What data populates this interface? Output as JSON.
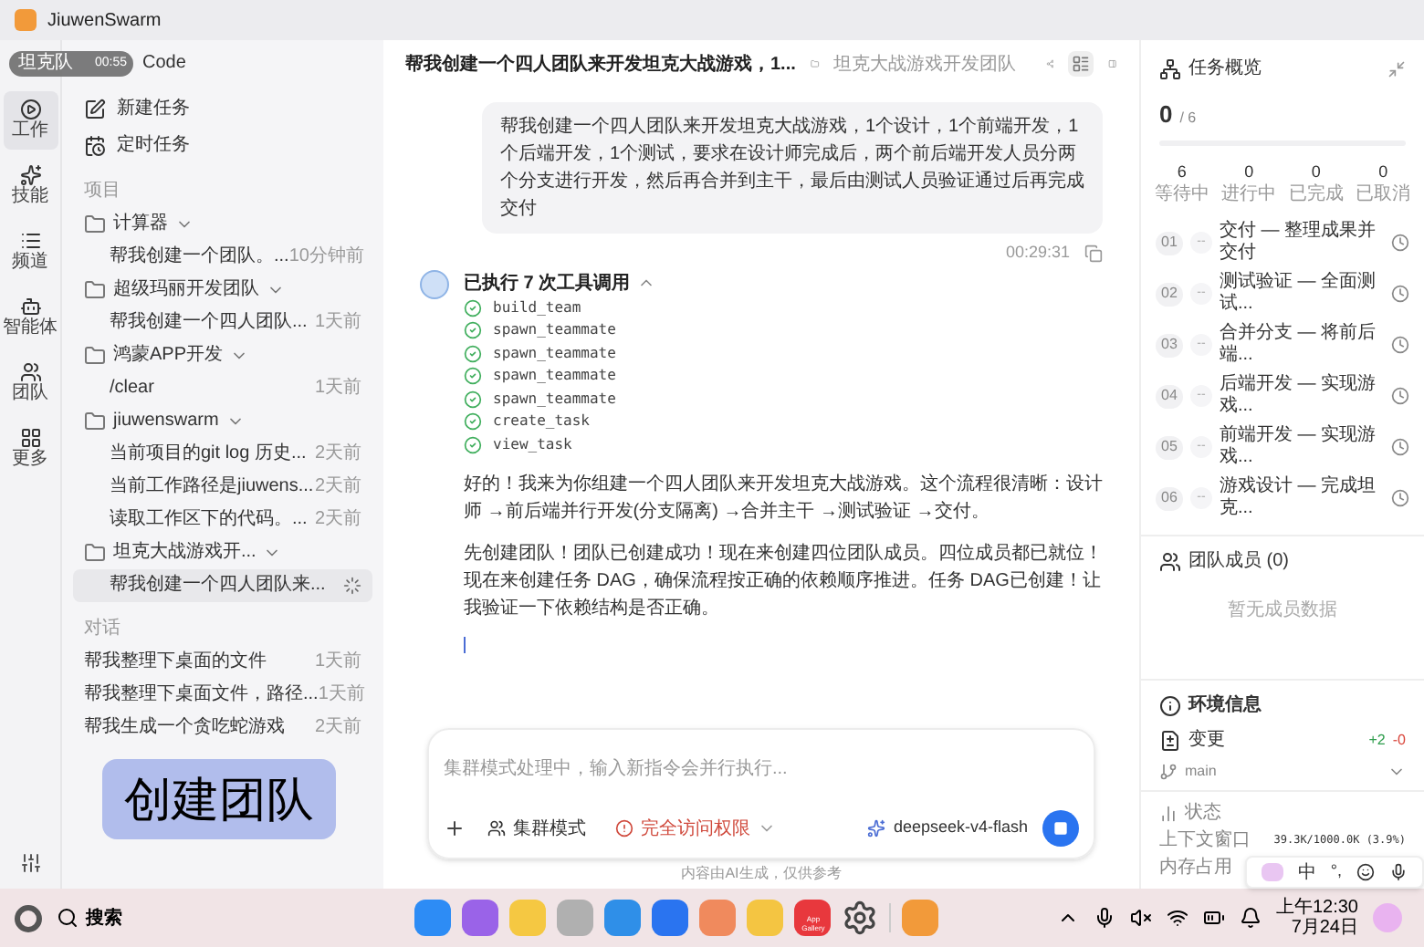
{
  "window": {
    "title": "JiuwenSwarm"
  },
  "overlay": {
    "recorder_label": "坦克队",
    "recorder_time": "00:55",
    "behind_text": "Code",
    "badge": "创建团队"
  },
  "rail": [
    {
      "label": "工作",
      "selected": true
    },
    {
      "label": "技能",
      "selected": false
    },
    {
      "label": "频道",
      "selected": false
    },
    {
      "label": "智能体",
      "selected": false
    },
    {
      "label": "团队",
      "selected": false
    },
    {
      "label": "更多",
      "selected": false
    }
  ],
  "sidebar": {
    "actions": [
      {
        "label": "新建任务"
      },
      {
        "label": "定时任务"
      }
    ],
    "projects_label": "项目",
    "projects": [
      {
        "name": "计算器",
        "expanded": true,
        "sessions": [
          {
            "title": "帮我创建一个团队。...",
            "time": "10分钟前",
            "selected": false,
            "kind": "time"
          }
        ]
      },
      {
        "name": "超级玛丽开发团队",
        "expanded": true,
        "sessions": [
          {
            "title": "帮我创建一个四人团队...",
            "time": "1天前",
            "selected": false,
            "kind": "time"
          }
        ]
      },
      {
        "name": "鸿蒙APP开发",
        "expanded": true,
        "sessions": [
          {
            "title": "/clear",
            "time": "1天前",
            "selected": false,
            "kind": "time"
          }
        ]
      },
      {
        "name": "jiuwenswarm",
        "expanded": true,
        "sessions": [
          {
            "title": "当前项目的git log 历史...",
            "time": "2天前",
            "selected": false,
            "kind": "time"
          },
          {
            "title": "当前工作路径是jiuwens...",
            "time": "2天前",
            "selected": false,
            "kind": "time"
          },
          {
            "title": "读取工作区下的代码。...",
            "time": "2天前",
            "selected": false,
            "kind": "time"
          }
        ]
      },
      {
        "name": "坦克大战游戏开...",
        "expanded": true,
        "sessions": [
          {
            "title": "帮我创建一个四人团队来...",
            "selected": true,
            "kind": "running"
          }
        ]
      }
    ],
    "chats_label": "对话",
    "chats": [
      {
        "title": "帮我整理下桌面的文件",
        "time": "1天前"
      },
      {
        "title": "帮我整理下桌面文件，路径...",
        "time": "1天前"
      },
      {
        "title": "帮我生成一个贪吃蛇游戏",
        "time": "2天前"
      }
    ]
  },
  "header": {
    "title": "帮我创建一个四人团队来开发坦克大战游戏，1...",
    "folder": "坦克大战游戏开发团队"
  },
  "conversation": {
    "user_message": "帮我创建一个四人团队来开发坦克大战游戏，1个设计，1个前端开发，1个后端开发，1个测试，要求在设计师完成后，两个前后端开发人员分两个分支进行开发，然后再合并到主干，最后由测试人员验证通过后再完成交付",
    "user_time": "00:29:31",
    "tool_summary": "已执行 7 次工具调用",
    "tools_expanded": true,
    "tools": [
      {
        "name": "build_team",
        "done": true
      },
      {
        "name": "spawn_teammate",
        "done": true
      },
      {
        "name": "spawn_teammate",
        "done": true
      },
      {
        "name": "spawn_teammate",
        "done": true
      },
      {
        "name": "spawn_teammate",
        "done": true
      },
      {
        "name": "create_task",
        "done": true
      },
      {
        "name": "view_task",
        "done": true
      }
    ],
    "paragraphs": [
      "好的！我来为你组建一个四人团队来开发坦克大战游戏。这个流程很清晰：设计师 →前后端并行开发(分支隔离) →合并主干 →测试验证 →交付。",
      "先创建团队！团队已创建成功！现在来创建四位团队成员。四位成员都已就位！现在来创建任务 DAG，确保流程按正确的依赖顺序推进。任务 DAG已创建！让我验证一下依赖结构是否正确。"
    ],
    "streaming": true
  },
  "composer": {
    "placeholder": "集群模式处理中，输入新指令会并行执行...",
    "mode": "集群模式",
    "permission": "完全访问权限",
    "model": "deepseek-v4-flash",
    "running": true,
    "footer": "内容由AI生成，仅供参考"
  },
  "task_overview": {
    "title": "任务概览",
    "done": "0",
    "total": "/ 6",
    "level": 0,
    "stats": [
      {
        "value": "6",
        "label": "等待中"
      },
      {
        "value": "0",
        "label": "进行中"
      },
      {
        "value": "0",
        "label": "已完成"
      },
      {
        "value": "0",
        "label": "已取消"
      }
    ],
    "tasks": [
      {
        "index": "01",
        "dash": "--",
        "text": "交付 — 整理成果并交付"
      },
      {
        "index": "02",
        "dash": "--",
        "text": "测试验证 — 全面测试..."
      },
      {
        "index": "03",
        "dash": "--",
        "text": "合并分支 — 将前后端..."
      },
      {
        "index": "04",
        "dash": "--",
        "text": "后端开发 — 实现游戏..."
      },
      {
        "index": "05",
        "dash": "--",
        "text": "前端开发 — 实现游戏..."
      },
      {
        "index": "06",
        "dash": "--",
        "text": "游戏设计 — 完成坦克..."
      }
    ]
  },
  "team_members": {
    "title": "团队成员 (0)",
    "empty": "暂无成员数据"
  },
  "environment": {
    "title": "环境信息",
    "changes_label": "变更",
    "added": "+2",
    "removed": "-0",
    "branch": "main"
  },
  "status": {
    "title": "状态",
    "context_label": "上下文窗口",
    "context_value": "39.3K/1000.0K (3.9%)",
    "memory_label": "内存占用"
  },
  "ime": {
    "chinese": "中",
    "punct": "°,"
  },
  "taskbar": {
    "search": "搜索",
    "app_gallery": "App Gallery",
    "time": "上午12:30",
    "date": "7月24日"
  }
}
